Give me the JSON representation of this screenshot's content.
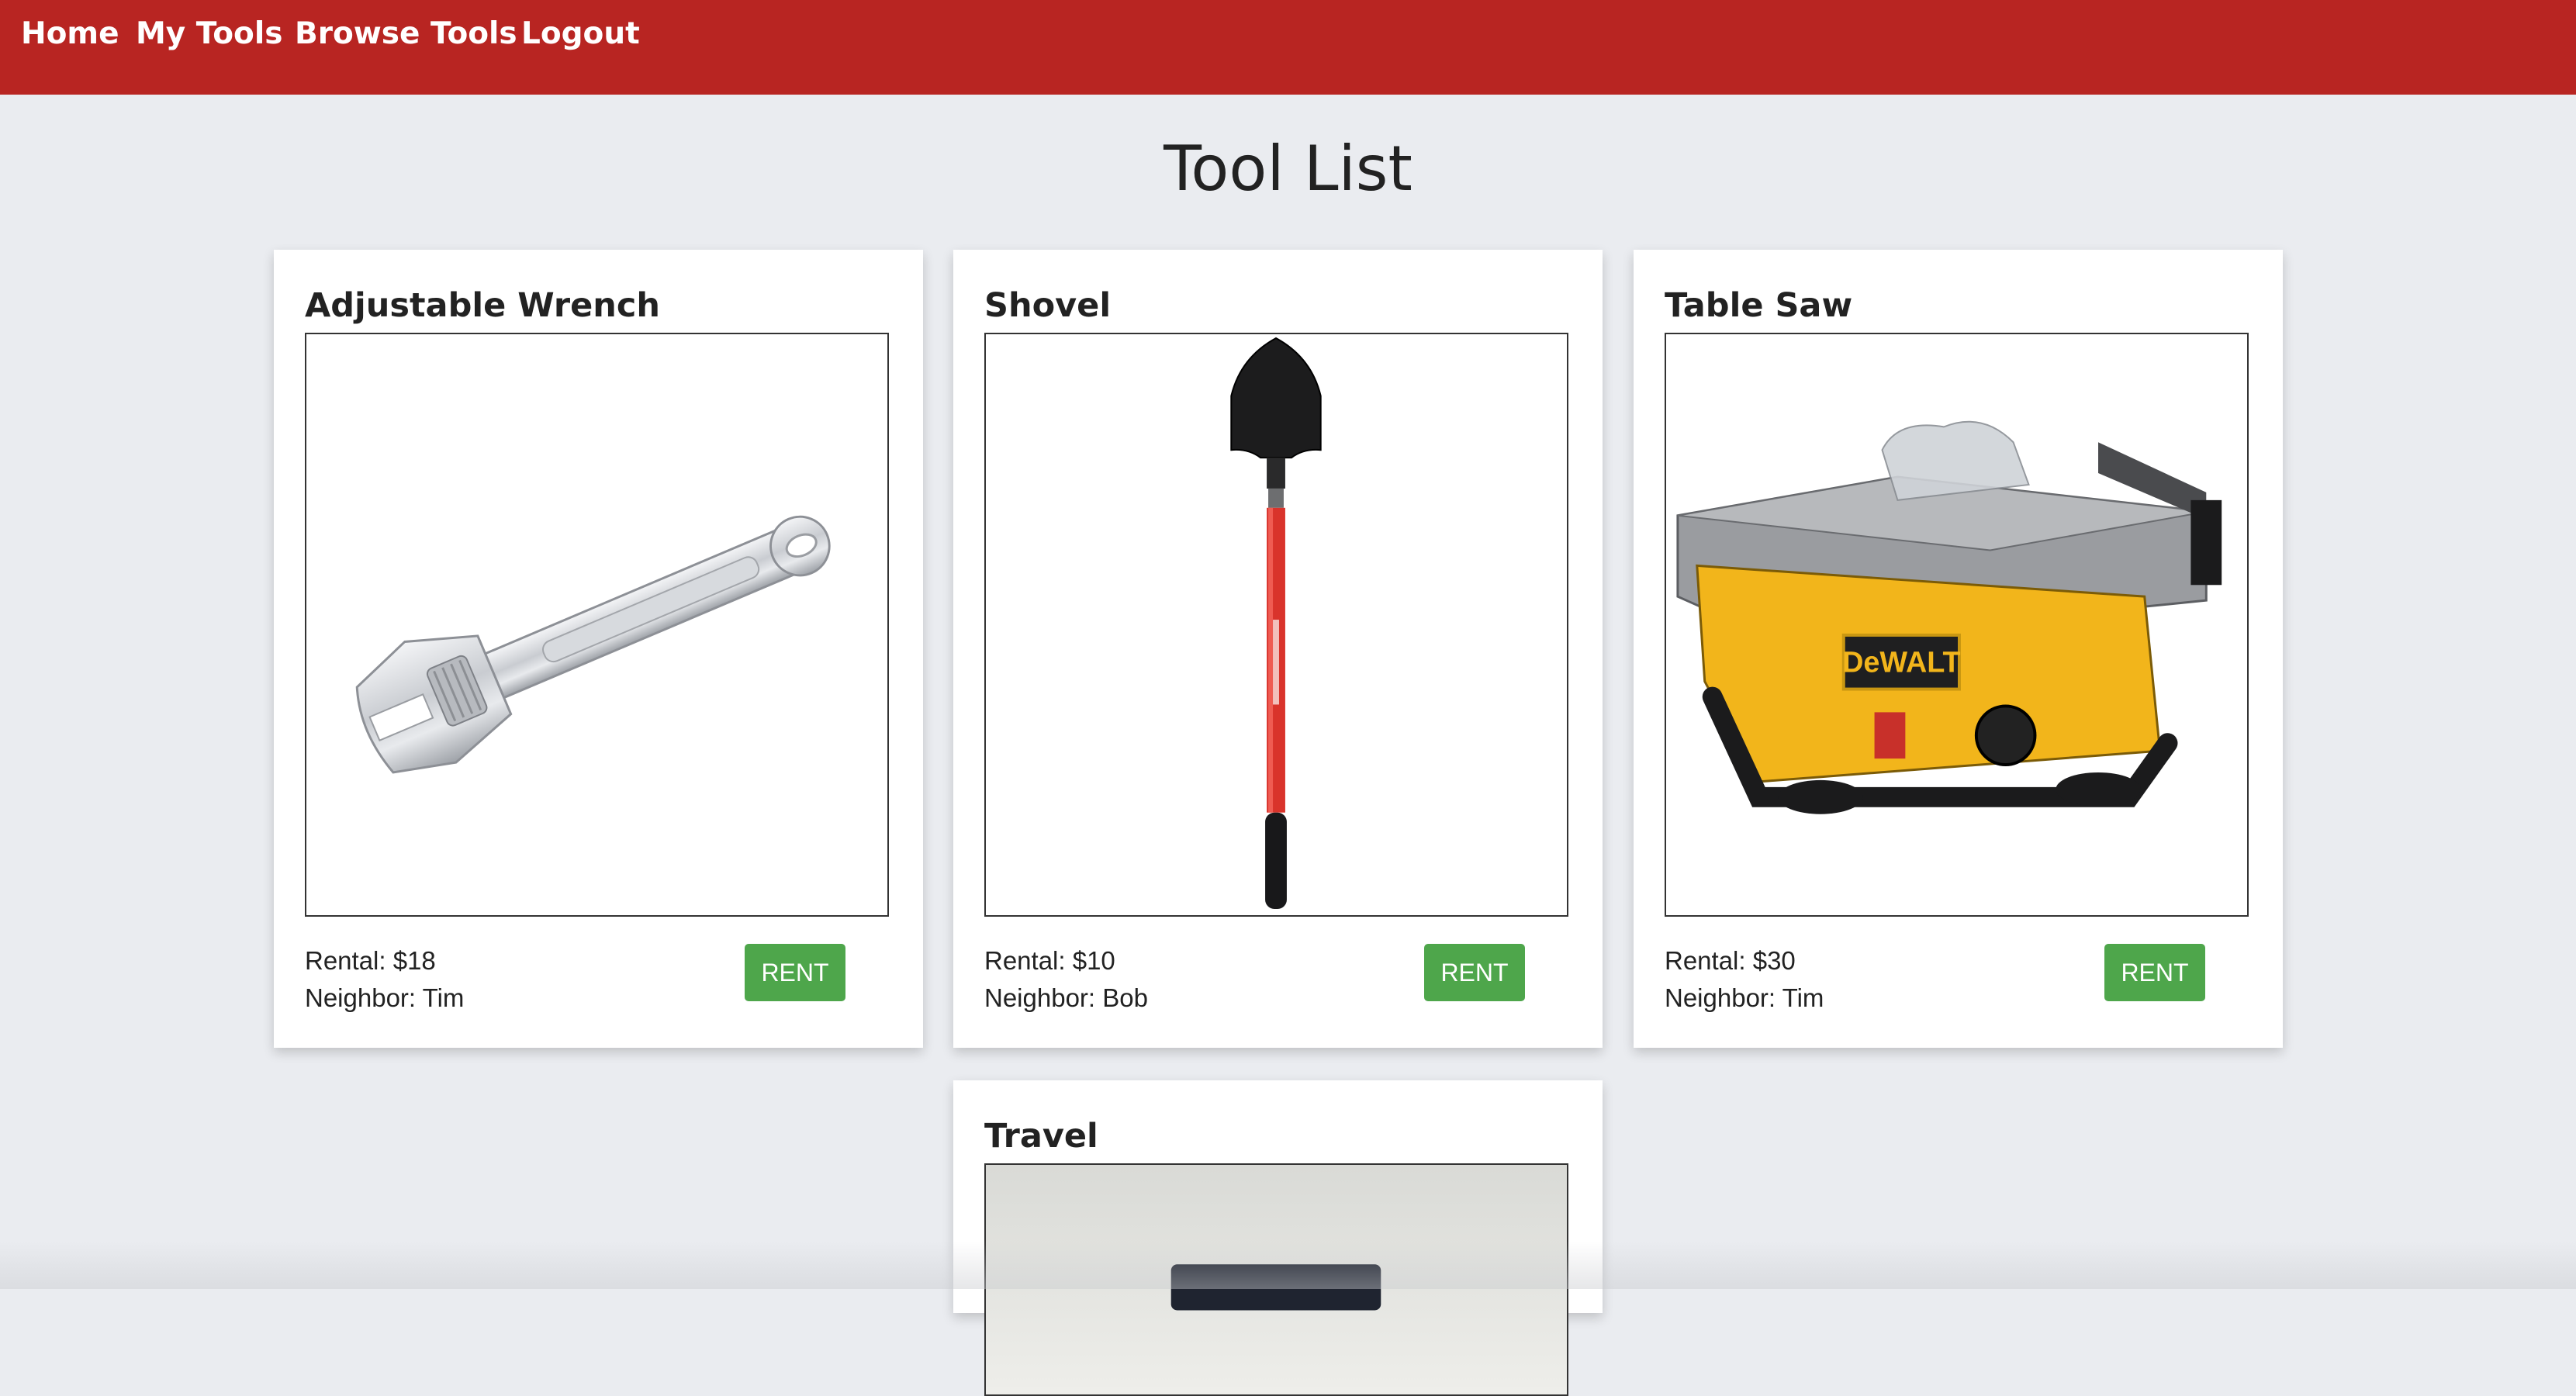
{
  "nav": {
    "items": [
      {
        "label": "Home"
      },
      {
        "label": "My Tools"
      },
      {
        "label": "Browse Tools"
      },
      {
        "label": "Logout"
      }
    ]
  },
  "page": {
    "title": "Tool List"
  },
  "tools": [
    {
      "name": "Adjustable Wrench",
      "rental": "Rental: $18",
      "neighbor": "Neighbor: Tim",
      "button_label": "RENT",
      "image_icon": "wrench-image"
    },
    {
      "name": "Shovel",
      "rental": "Rental: $10",
      "neighbor": "Neighbor: Bob",
      "button_label": "RENT",
      "image_icon": "shovel-image"
    },
    {
      "name": "Table Saw",
      "rental": "Rental: $30",
      "neighbor": "Neighbor: Tim",
      "button_label": "RENT",
      "image_icon": "table-saw-image"
    },
    {
      "name": "Travel",
      "image_icon": "travel-image"
    }
  ],
  "colors": {
    "navbar": "#b82522",
    "page_background": "#eaecf0",
    "rent_button": "#4ea64b",
    "card": "#ffffff"
  }
}
